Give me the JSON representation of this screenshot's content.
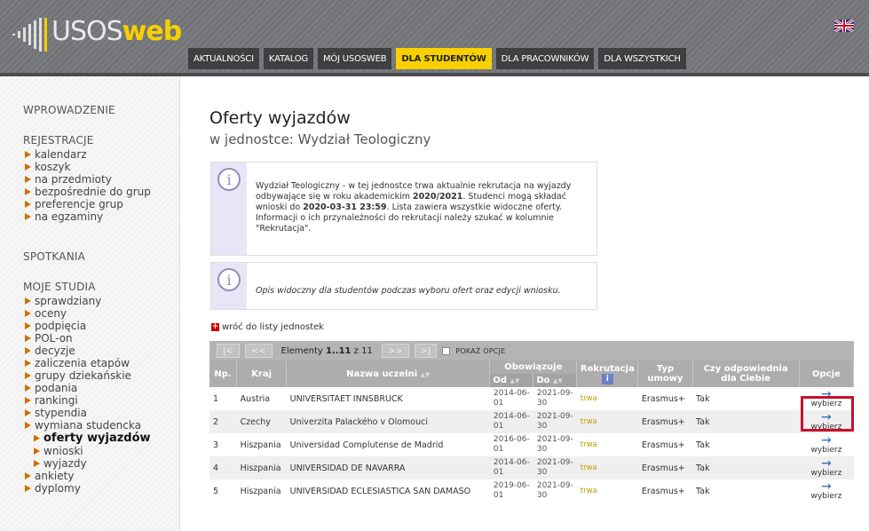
{
  "header": {
    "logo_text_plain": "USOS",
    "logo_text_bold": "web",
    "tabs": [
      {
        "label": "AKTUALNOŚCI"
      },
      {
        "label": "KATALOG"
      },
      {
        "label": "MÓJ USOSWEB"
      },
      {
        "label": "DLA STUDENTÓW",
        "active": true
      },
      {
        "label": "DLA PRACOWNIKÓW"
      },
      {
        "label": "DLA WSZYSTKICH"
      }
    ],
    "language_flag": "uk-flag-icon"
  },
  "sidebar": {
    "sections": [
      {
        "title": "WPROWADZENIE"
      },
      {
        "title": "REJESTRACJE",
        "items": [
          "kalendarz",
          "koszyk",
          "na przedmioty",
          "bezpośrednie do grup",
          "preferencje grup",
          "na egzaminy"
        ]
      },
      {
        "title": "SPOTKANIA"
      },
      {
        "title": "MOJE STUDIA",
        "items": [
          "sprawdziany",
          "oceny",
          "podpięcia",
          "POL-on",
          "decyzje",
          "zaliczenia etapów",
          "grupy dziekańskie",
          "podania",
          "rankingi",
          "stypendia",
          "wymiana studencka",
          "oferty wyjazdów",
          "wnioski",
          "wyjazdy",
          "ankiety",
          "dyplomy"
        ]
      }
    ]
  },
  "main": {
    "title": "Oferty wyjazdów",
    "subtitle": "w jednostce: Wydział Teologiczny",
    "info1": {
      "l1": "Wydział Teologiczny - w tej jednostce trwa aktualnie rekrutacja na wyjazdy",
      "l2a": "odbywające się w roku akademickim ",
      "l2b": "2020/2021",
      "l2c": ". Studenci mogą składać",
      "l3a": "wnioski do ",
      "l3b": "2020-03-31 23:59",
      "l3c": ". Lista zawiera wszystkie widoczne oferty.",
      "l4": "Informacji o ich przynależności do rekrutacji należy szukać w kolumnie",
      "l5": "\"Rekrutacja\"."
    },
    "info2": "Opis widoczny dla studentów podczas wyboru ofert oraz edycji wniosku.",
    "back_link": "wróć do listy jednostek",
    "pager": {
      "first": "|<",
      "prev": "<<",
      "count_prefix": "Elementy ",
      "count_range": "1..11",
      "count_suffix": " z 11",
      "next": ">>",
      "last": ">|",
      "show_options": "POKAŻ OPCJE"
    },
    "table": {
      "headers": {
        "np": "Np.",
        "kraj": "Kraj",
        "uczelnia": "Nazwa uczelni",
        "obowiazuje": "Obowiązuje",
        "od": "Od",
        "do": "Do",
        "rekrutacja": "Rekrutacja",
        "typ": "Typ umowy",
        "odpowiednia": "Czy odpowiednia dla Ciebie",
        "opcje": "Opcje"
      },
      "rows": [
        {
          "np": "1",
          "kraj": "Austria",
          "uczelnia": "UNIVERSITAET INNSBRUCK",
          "od_a": "2014-06-",
          "od_b": "01",
          "do_a": "2021-09-",
          "do_b": "30",
          "rekrutacja": "trwa",
          "typ": "Erasmus+",
          "odpowiednia": "Tak",
          "opcja": "wybierz"
        },
        {
          "np": "2",
          "kraj": "Czechy",
          "uczelnia": "Univerzita Palackého v Olomouci",
          "od_a": "2014-06-",
          "od_b": "01",
          "do_a": "2021-09-",
          "do_b": "30",
          "rekrutacja": "trwa",
          "typ": "Erasmus+",
          "odpowiednia": "Tak",
          "opcja": "wybierz"
        },
        {
          "np": "3",
          "kraj": "Hiszpania",
          "uczelnia": "Universidad Complutense de Madrid",
          "od_a": "2016-06-",
          "od_b": "01",
          "do_a": "2021-09-",
          "do_b": "30",
          "rekrutacja": "trwa",
          "typ": "Erasmus+",
          "odpowiednia": "Tak",
          "opcja": "wybierz"
        },
        {
          "np": "4",
          "kraj": "Hiszpania",
          "uczelnia": "UNIVERSIDAD DE NAVARRA",
          "od_a": "2014-06-",
          "od_b": "01",
          "do_a": "2021-09-",
          "do_b": "30",
          "rekrutacja": "trwa",
          "typ": "Erasmus+",
          "odpowiednia": "Tak",
          "opcja": "wybierz"
        },
        {
          "np": "5",
          "kraj": "Hiszpania",
          "uczelnia": "UNIVERSIDAD ECLESIASTICA SAN DAMASO",
          "od_a": "2019-06-",
          "od_b": "01",
          "do_a": "2021-09-",
          "do_b": "30",
          "rekrutacja": "trwa",
          "typ": "Erasmus+",
          "odpowiednia": "Tak",
          "opcja": "wybierz"
        }
      ]
    }
  },
  "colors": {
    "accent": "#f8d000",
    "highlight": "#c8102e",
    "link": "#2d6bb5"
  }
}
